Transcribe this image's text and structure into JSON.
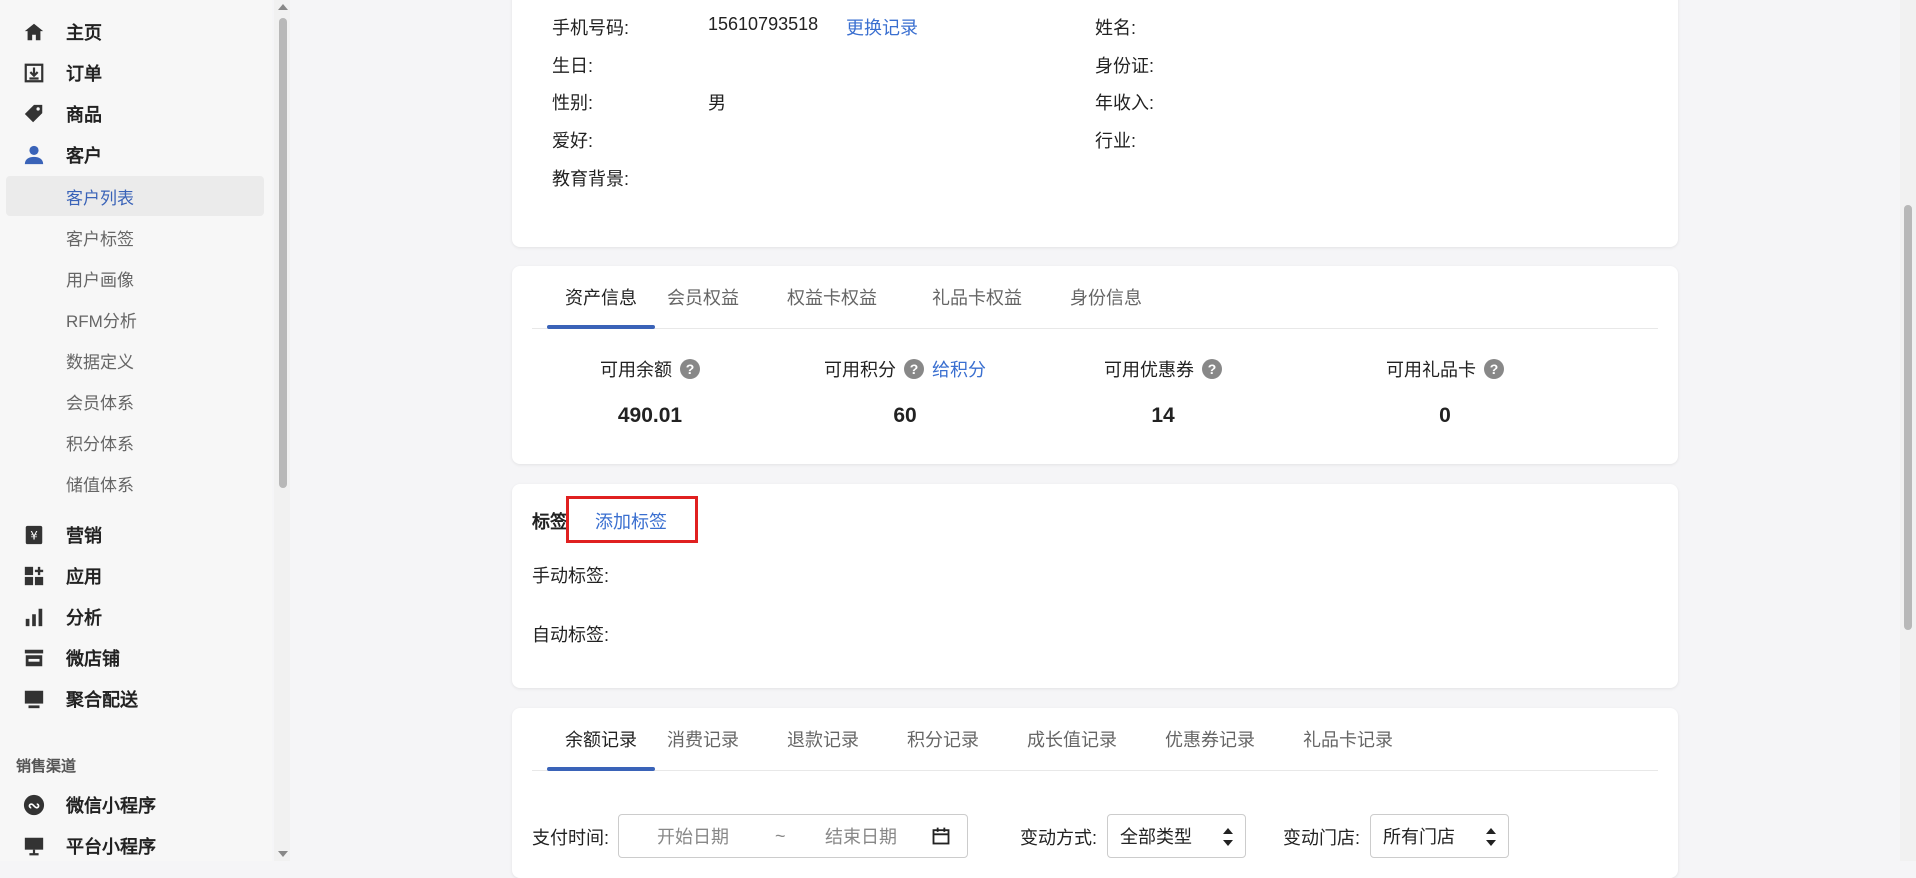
{
  "sidebar": {
    "nav": [
      {
        "label": "主页",
        "icon": "home-icon"
      },
      {
        "label": "订单",
        "icon": "download-box-icon"
      },
      {
        "label": "商品",
        "icon": "tag-icon"
      },
      {
        "label": "客户",
        "icon": "user-icon"
      }
    ],
    "sub_items": [
      {
        "label": "客户列表",
        "active": true
      },
      {
        "label": "客户标签"
      },
      {
        "label": "用户画像"
      },
      {
        "label": "RFM分析"
      },
      {
        "label": "数据定义"
      },
      {
        "label": "会员体系"
      },
      {
        "label": "积分体系"
      },
      {
        "label": "储值体系"
      }
    ],
    "nav2": [
      {
        "label": "营销",
        "icon": "yen-icon"
      },
      {
        "label": "应用",
        "icon": "apps-icon"
      },
      {
        "label": "分析",
        "icon": "bar-chart-icon"
      },
      {
        "label": "微店铺",
        "icon": "store-icon"
      },
      {
        "label": "聚合配送",
        "icon": "monitor-icon"
      }
    ],
    "section_title": "销售渠道",
    "channels": [
      {
        "label": "微信小程序",
        "icon": "mini-program-icon"
      },
      {
        "label": "平台小程序",
        "icon": "platform-icon"
      }
    ]
  },
  "profile": {
    "phone_label": "手机号码:",
    "phone_value": "15610793518",
    "change_link": "更换记录",
    "birthday_label": "生日:",
    "gender_label": "性别:",
    "gender_value": "男",
    "hobby_label": "爱好:",
    "education_label": "教育背景:",
    "name_label": "姓名:",
    "id_label": "身份证:",
    "income_label": "年收入:",
    "industry_label": "行业:"
  },
  "assets": {
    "tabs": [
      "资产信息",
      "会员权益",
      "权益卡权益",
      "礼品卡权益",
      "身份信息"
    ],
    "stats": [
      {
        "title": "可用余额",
        "value": "490.01"
      },
      {
        "title": "可用积分",
        "value": "60",
        "link": "给积分"
      },
      {
        "title": "可用优惠券",
        "value": "14"
      },
      {
        "title": "可用礼品卡",
        "value": "0"
      }
    ]
  },
  "tags": {
    "title": "标签",
    "add_link": "添加标签",
    "manual_label": "手动标签:",
    "auto_label": "自动标签:"
  },
  "records": {
    "tabs": [
      "余额记录",
      "消费记录",
      "退款记录",
      "积分记录",
      "成长值记录",
      "优惠券记录",
      "礼品卡记录"
    ],
    "pay_time_label": "支付时间:",
    "start_placeholder": "开始日期",
    "range_sep": "~",
    "end_placeholder": "结束日期",
    "change_type_label": "变动方式:",
    "change_type_value": "全部类型",
    "store_label": "变动门店:",
    "store_value": "所有门店"
  },
  "colors": {
    "accent": "#3a63b8",
    "link": "#3a6fd0",
    "highlight": "#e02020"
  }
}
